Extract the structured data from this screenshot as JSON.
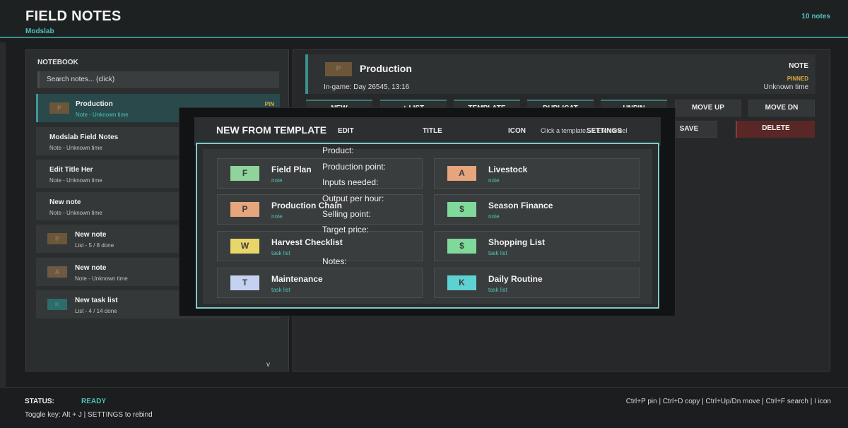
{
  "header": {
    "title": "FIELD NOTES",
    "subtitle": "Modslab",
    "note_count": "10 notes"
  },
  "sidebar": {
    "title": "NOTEBOOK",
    "search_placeholder": "Search notes... (click)",
    "scroll_glyph": "v",
    "items": [
      {
        "name": "Production",
        "meta": "Note - Unknown time",
        "icon": "P",
        "icon_color": "#6c5639",
        "pin": "PIN"
      },
      {
        "name": "Modslab Field Notes",
        "meta": "Note - Unknown time"
      },
      {
        "name": "Edit Title Her",
        "meta": "Note - Unknown time"
      },
      {
        "name": "New note",
        "meta": "Note - Unknown time"
      },
      {
        "name": "New note",
        "meta": "List - 5 / 8 done",
        "icon": "P",
        "icon_color": "#6c5639"
      },
      {
        "name": "New note",
        "meta": "Note - Unknown time",
        "icon": "A",
        "icon_color": "#6e5a43"
      },
      {
        "name": "New task list",
        "meta": "List - 4 / 14 done",
        "icon": "K",
        "icon_color": "#2e6b6b"
      }
    ]
  },
  "detail": {
    "icon": "P",
    "title": "Production",
    "subtitle": "In-game: Day 26545, 13:16",
    "type": "NOTE",
    "pinned": "PINNED",
    "time": "Unknown time"
  },
  "toolbar": {
    "new": "NEW",
    "list": "+ LIST",
    "template": "TEMPLATE",
    "duplicate": "DUPLICAT",
    "unpin": "UNPIN",
    "move_up": "MOVE UP",
    "move_dn": "MOVE DN",
    "edit": "EDIT",
    "title": "TITLE",
    "icon": "ICON",
    "settings": "SETTINGS",
    "save": "SAVE",
    "delete": "DELETE"
  },
  "modal": {
    "title": "NEW FROM TEMPLATE",
    "hint": "Click a template... / Esc cancel",
    "templates": [
      {
        "name": "Field Plan",
        "type": "note",
        "icon": "F",
        "color": "#8fd49a"
      },
      {
        "name": "Livestock",
        "type": "note",
        "icon": "A",
        "color": "#e6a57c"
      },
      {
        "name": "Production Chain",
        "type": "note",
        "icon": "P",
        "color": "#e6a57c"
      },
      {
        "name": "Season Finance",
        "type": "note",
        "icon": "$",
        "color": "#7fd99b"
      },
      {
        "name": "Harvest Checklist",
        "type": "task list",
        "icon": "W",
        "color": "#e8d66a"
      },
      {
        "name": "Shopping List",
        "type": "task list",
        "icon": "$",
        "color": "#7fd99b"
      },
      {
        "name": "Maintenance",
        "type": "task list",
        "icon": "T",
        "color": "#c4d1f0"
      },
      {
        "name": "Daily Routine",
        "type": "task list",
        "icon": "K",
        "color": "#5ed2d2"
      }
    ]
  },
  "note_body": [
    "Product:",
    "Production point:",
    "Inputs needed:",
    "Output per hour:",
    "Selling point:",
    "Target price:",
    "",
    "Notes:"
  ],
  "footer": {
    "status_label": "STATUS:",
    "status_value": "READY",
    "toggle": "Toggle key: Alt + J  |  SETTINGS to rebind",
    "shortcuts": "Ctrl+P pin | Ctrl+D copy | Ctrl+Up/Dn move | Ctrl+F search | I icon"
  }
}
